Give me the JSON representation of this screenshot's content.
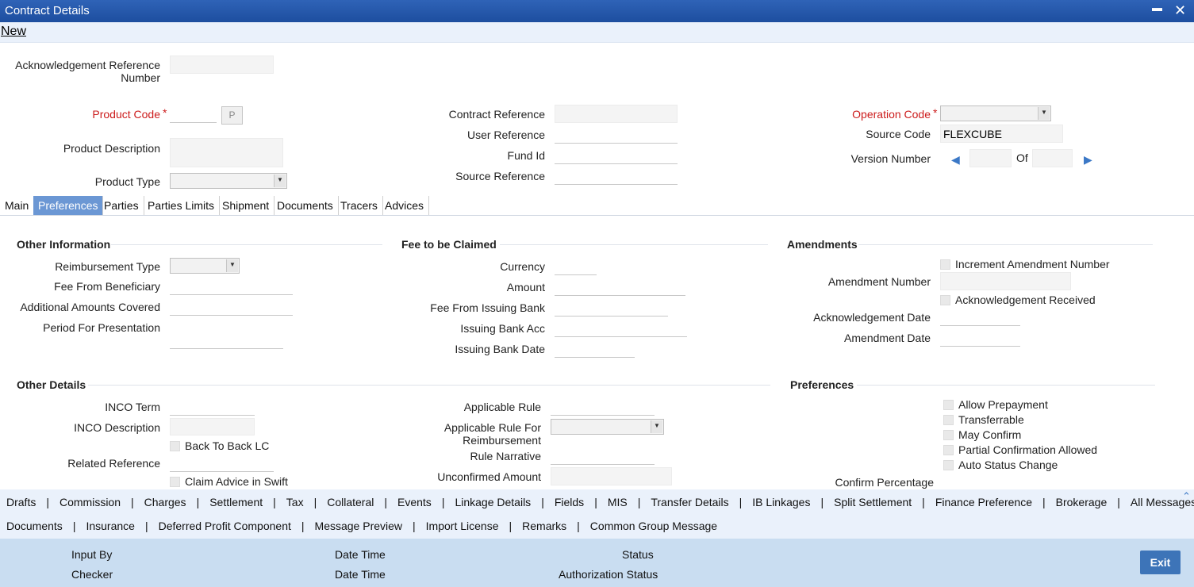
{
  "window": {
    "title": "Contract Details",
    "minimize": "▬",
    "close": "✕"
  },
  "menu": {
    "new": "New"
  },
  "header": {
    "ack_ref_label_1": "Acknowledgement Reference",
    "ack_ref_label_2": "Number",
    "product_code_label": "Product Code",
    "required_mark": "*",
    "product_btn": "P",
    "product_description_label": "Product Description",
    "product_type_label": "Product Type",
    "contract_reference_label": "Contract Reference",
    "user_reference_label": "User Reference",
    "fund_id_label": "Fund Id",
    "source_reference_label": "Source Reference",
    "operation_code_label": "Operation Code",
    "source_code_label": "Source Code",
    "source_code_value": "FLEXCUBE",
    "version_number_label": "Version Number",
    "of_label": "Of"
  },
  "tabs": [
    "Main",
    "Preferences",
    "Parties",
    "Parties Limits",
    "Shipment",
    "Documents",
    "Tracers",
    "Advices"
  ],
  "other_information": {
    "title": "Other Information",
    "reimbursement_type": "Reimbursement Type",
    "fee_from_beneficiary": "Fee From Beneficiary",
    "additional_amounts_covered": "Additional Amounts Covered",
    "period_for_presentation": "Period For Presentation"
  },
  "fee_to_be_claimed": {
    "title": "Fee to be Claimed",
    "currency": "Currency",
    "amount": "Amount",
    "fee_from_issuing_bank": "Fee From Issuing Bank",
    "issuing_bank_acc": "Issuing Bank Acc",
    "issuing_bank_date": "Issuing Bank Date"
  },
  "amendments": {
    "title": "Amendments",
    "increment_amendment_number": "Increment Amendment Number",
    "amendment_number": "Amendment Number",
    "acknowledgement_received": "Acknowledgement Received",
    "acknowledgement_date": "Acknowledgement Date",
    "amendment_date": "Amendment Date"
  },
  "other_details": {
    "title": "Other Details",
    "inco_term": "INCO Term",
    "inco_description": "INCO Description",
    "back_to_back_lc": "Back To Back LC",
    "related_reference": "Related Reference",
    "claim_advice_in_swift": "Claim Advice in Swift",
    "applicable_rule": "Applicable Rule",
    "applicable_rule_reimb_1": "Applicable Rule For",
    "applicable_rule_reimb_2": "Reimbursement",
    "rule_narrative": "Rule Narrative",
    "unconfirmed_amount": "Unconfirmed Amount"
  },
  "preferences": {
    "title": "Preferences",
    "allow_prepayment": "Allow Prepayment",
    "transferrable": "Transferrable",
    "may_confirm": "May Confirm",
    "partial_confirmation_allowed": "Partial Confirmation Allowed",
    "auto_status_change": "Auto Status Change",
    "confirm_percentage": "Confirm Percentage"
  },
  "bottom_links_row1": [
    "Drafts",
    "Commission",
    "Charges",
    "Settlement",
    "Tax",
    "Collateral",
    "Events",
    "Linkage Details",
    "Fields",
    "MIS",
    "Transfer Details",
    "IB Linkages",
    "Split Settlement",
    "Finance Preference",
    "Brokerage",
    "All Messages"
  ],
  "bottom_links_row2": [
    "Documents",
    "Insurance",
    "Deferred Profit Component",
    "Message Preview",
    "Import License",
    "Remarks",
    "Common Group Message"
  ],
  "separator": "|",
  "scroll_up": "⌃",
  "footer": {
    "input_by": "Input By",
    "checker": "Checker",
    "date_time_1": "Date Time",
    "date_time_2": "Date Time",
    "status": "Status",
    "authorization_status": "Authorization Status",
    "exit": "Exit"
  }
}
